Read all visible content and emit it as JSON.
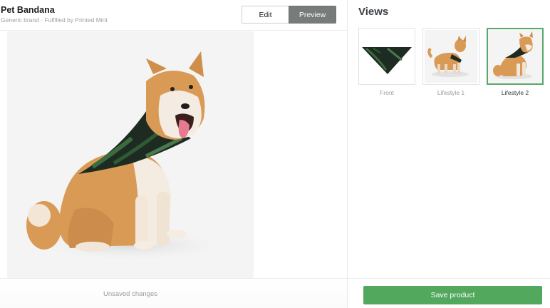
{
  "product": {
    "title": "Pet Bandana",
    "subtitle": "Generic brand · Fulfilled by Printed Mint"
  },
  "mode_toggle": {
    "edit_label": "Edit",
    "preview_label": "Preview",
    "active": "preview"
  },
  "preview": {
    "image": "dog-wearing-bandana",
    "background_color": "#f4f4f4"
  },
  "status": {
    "unsaved_text": "Unsaved changes"
  },
  "views": {
    "title": "Views",
    "items": [
      {
        "label": "Front",
        "image": "bandana-front",
        "selected": false
      },
      {
        "label": "Lifestyle 1",
        "image": "dog-standing",
        "selected": false
      },
      {
        "label": "Lifestyle 2",
        "image": "dog-sitting",
        "selected": true
      }
    ]
  },
  "actions": {
    "save_label": "Save product"
  },
  "colors": {
    "accent_green": "#52a85d",
    "selected_border": "#5aa86a",
    "preview_button": "#777b7a"
  }
}
